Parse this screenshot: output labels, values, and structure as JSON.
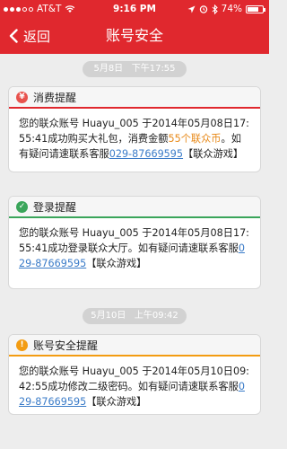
{
  "status_bar": {
    "carrier": "AT&T",
    "time": "9:16 PM",
    "battery": "74%",
    "battery_level": 0.74
  },
  "navbar": {
    "back_label": "返回",
    "title": "账号安全"
  },
  "messages": [
    {
      "date": "5月8日   下午17:55",
      "title": "消费提醒",
      "badge": "¥",
      "body_parts": [
        "您的联众账号  Huayu_005 于2014年05月08日17:55:41成功购买大礼包，消费金额",
        "55个联众币",
        "。如有疑问请速联系客服",
        "029-87669595",
        "【联众游戏】"
      ]
    },
    {
      "title": "登录提醒",
      "badge": "✓",
      "body_parts": [
        "您的联众账号  Huayu_005 于2014年05月08日17:55:41成功登录联众大厅。如有疑问请速联系客服",
        "029-87669595",
        "【联众游戏】"
      ]
    },
    {
      "date": "5月10日   上午09:42",
      "title": "账号安全提醒",
      "badge": "!",
      "body_parts": [
        "您的联众账号  Huayu_005 于2014年05月10日09:42:55成功修改二级密码。如有疑问请速联系客服",
        "029-87669595",
        "【联众游戏】"
      ]
    }
  ],
  "colors": {
    "brand_red": "#e0282e",
    "highlight_orange": "#e88a1a",
    "link_blue": "#3a7bc8"
  }
}
